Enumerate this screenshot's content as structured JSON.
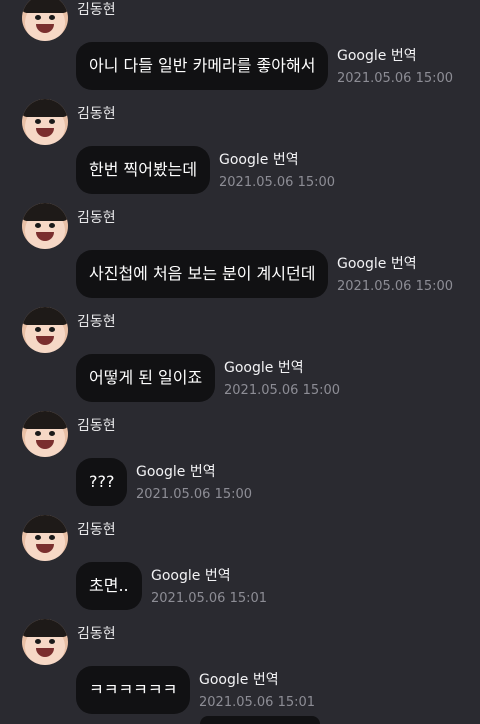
{
  "messages": [
    {
      "sender": "김동현",
      "text": "아니 다들 일반 카메라를 좋아해서",
      "translate_label": "Google 번역",
      "timestamp": "2021.05.06 15:00"
    },
    {
      "sender": "김동현",
      "text": "한번 찍어봤는데",
      "translate_label": "Google 번역",
      "timestamp": "2021.05.06 15:00"
    },
    {
      "sender": "김동현",
      "text": "사진첩에 처음 보는 분이 계시던데",
      "translate_label": "Google 번역",
      "timestamp": "2021.05.06 15:00"
    },
    {
      "sender": "김동현",
      "text": "어떻게 된 일이죠",
      "translate_label": "Google 번역",
      "timestamp": "2021.05.06 15:00"
    },
    {
      "sender": "김동현",
      "text": "???",
      "translate_label": "Google 번역",
      "timestamp": "2021.05.06 15:00"
    },
    {
      "sender": "김동현",
      "text": "초면..",
      "translate_label": "Google 번역",
      "timestamp": "2021.05.06 15:01"
    },
    {
      "sender": "김동현",
      "text": "ㅋㅋㅋㅋㅋㅋ",
      "translate_label": "Google 번역",
      "timestamp": "2021.05.06 15:01"
    }
  ],
  "colors": {
    "background": "#2a2a30",
    "bubble": "#111113",
    "timestamp": "#8d8d95"
  }
}
